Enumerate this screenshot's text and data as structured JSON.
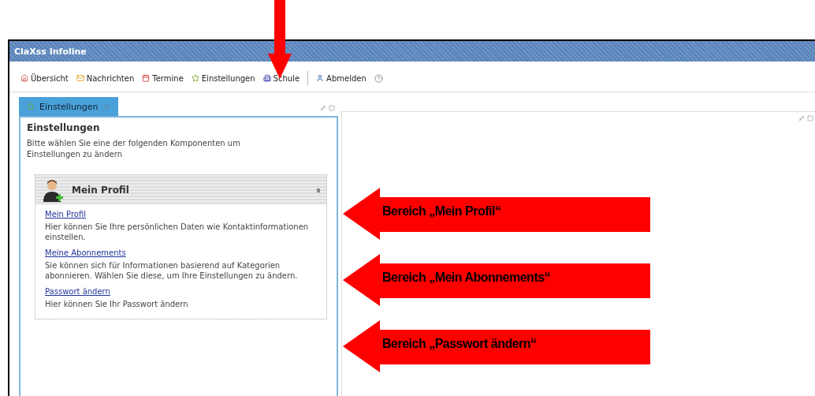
{
  "window": {
    "title": "ClaXss Infoline"
  },
  "toolbar": {
    "groups": [
      [
        "Übersicht",
        "Nachrichten",
        "Termine",
        "Einstellungen",
        "Schule"
      ],
      [
        "Abmelden"
      ]
    ]
  },
  "left_panel": {
    "tab": {
      "label": "Einstellungen",
      "selected": true
    },
    "heading": "Einstellungen",
    "intro": "Bitte wählen Sie eine der folgenden Komponenten um Einstellungen zu ändern",
    "card": {
      "title": "Mein Profil",
      "entries": [
        {
          "link": "Mein Profil",
          "description": "Hier können Sie Ihre persönlichen Daten wie Kontaktinformationen einstellen."
        },
        {
          "link": "Meine Abonnements",
          "description": "Sie können sich für Informationen basierend auf Kategorien abonnieren. Wählen Sie diese, um Ihre Einstellungen zu ändern."
        },
        {
          "link": "Passwort ändern",
          "description": "Hier können Sie Ihr Passwort ändern"
        }
      ]
    }
  },
  "annotations": [
    "Bereich „Mein Profil“",
    "Bereich „Mein Abonnements“",
    "Bereich „Passwort ändern“"
  ]
}
